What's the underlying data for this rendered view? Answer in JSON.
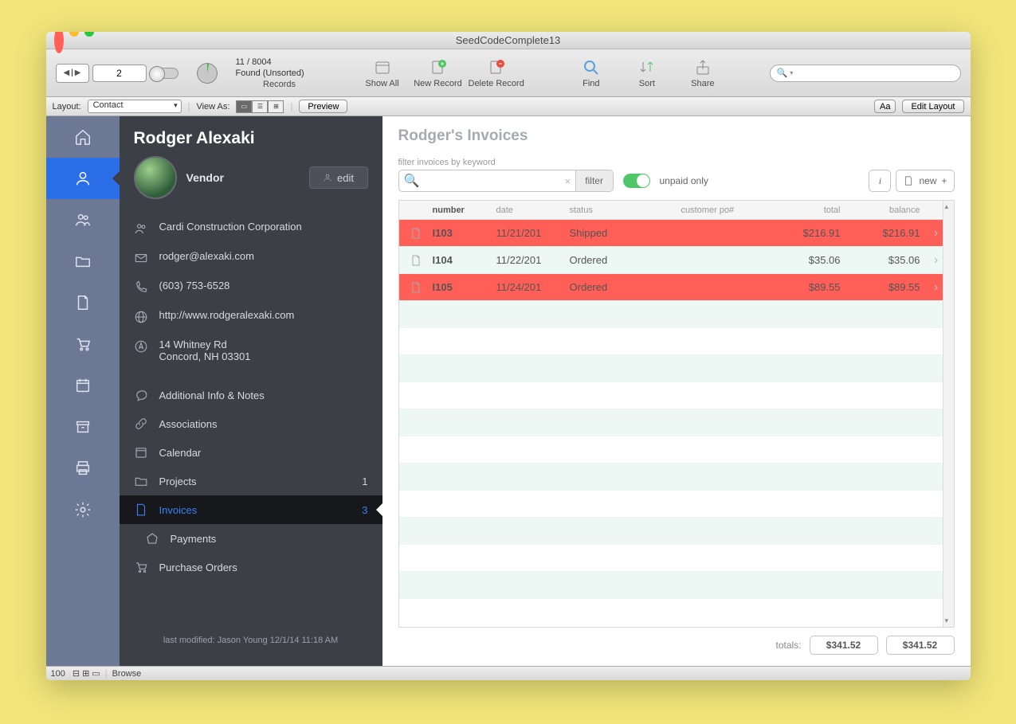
{
  "window": {
    "title": "SeedCodeComplete13"
  },
  "records": {
    "current": "2",
    "found": "11 / 8004",
    "status": "Found (Unsorted)",
    "label": "Records"
  },
  "toolbar": {
    "showall": "Show All",
    "newrec": "New Record",
    "delrec": "Delete Record",
    "find": "Find",
    "sort": "Sort",
    "share": "Share",
    "search_ph": "Q▾"
  },
  "layoutbar": {
    "layout_lbl": "Layout:",
    "layout_val": "Contact",
    "view_lbl": "View As:",
    "preview": "Preview",
    "editlayout": "Edit Layout",
    "aa": "Aa"
  },
  "contact": {
    "name": "Rodger Alexaki",
    "type": "Vendor",
    "edit": "edit",
    "company": "Cardi Construction Corporation",
    "email": "rodger@alexaki.com",
    "phone": "(603) 753-6528",
    "web": "http://www.rodgeralexaki.com",
    "addr1": "14 Whitney Rd",
    "addr2": "Concord, NH 03301",
    "lastmod": "last modified: Jason Young 12/1/14 11:18 AM"
  },
  "sections": {
    "addl": "Additional Info & Notes",
    "assoc": "Associations",
    "cal": "Calendar",
    "proj": "Projects",
    "proj_ct": "1",
    "inv": "Invoices",
    "inv_ct": "3",
    "pay": "Payments",
    "po": "Purchase Orders"
  },
  "main": {
    "heading": "Rodger's Invoices",
    "filter_lbl": "filter invoices by keyword",
    "filter_btn": "filter",
    "unpaid": "unpaid only",
    "info": "i",
    "new": "new",
    "cols": {
      "num": "number",
      "date": "date",
      "stat": "status",
      "po": "customer po#",
      "tot": "total",
      "bal": "balance"
    },
    "rows": [
      {
        "num": "I103",
        "date": "11/21/201",
        "stat": "Shipped",
        "tot": "$216.91",
        "bal": "$216.91"
      },
      {
        "num": "I104",
        "date": "11/22/201",
        "stat": "Ordered",
        "tot": "$35.06",
        "bal": "$35.06"
      },
      {
        "num": "I105",
        "date": "11/24/201",
        "stat": "Ordered",
        "tot": "$89.55",
        "bal": "$89.55"
      }
    ],
    "totals_lbl": "totals:",
    "total_sum": "$341.52",
    "balance_sum": "$341.52"
  },
  "footer": {
    "zoom": "100",
    "mode": "Browse"
  }
}
